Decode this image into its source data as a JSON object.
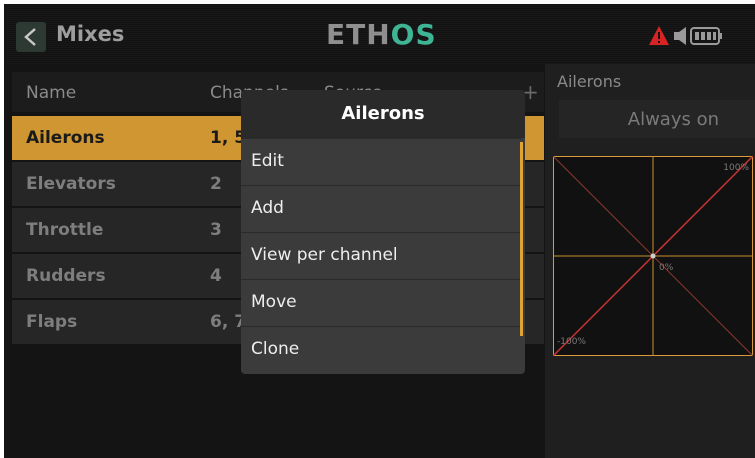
{
  "header": {
    "title": "Mixes",
    "logo_part1": "ETH",
    "logo_part2": "OS",
    "icons": [
      "back-icon",
      "warning-icon",
      "speaker-icon",
      "battery-icon"
    ],
    "accent_color": "#cf9631",
    "logo_accent": "#3fb596",
    "warning_color": "#d92323"
  },
  "list": {
    "columns": [
      "Name",
      "Channels",
      "Source"
    ],
    "add_label": "+",
    "rows": [
      {
        "name": "Ailerons",
        "channels": "1, 5",
        "selected": true
      },
      {
        "name": "Elevators",
        "channels": "2"
      },
      {
        "name": "Throttle",
        "channels": "3"
      },
      {
        "name": "Rudders",
        "channels": "4"
      },
      {
        "name": "Flaps",
        "channels": "6, 7"
      }
    ]
  },
  "right_panel": {
    "title": "Ailerons",
    "value": "Always on",
    "curve": {
      "top_right_label": "100%",
      "center_label": "0%",
      "bottom_left_label": "-100%"
    }
  },
  "popup": {
    "title": "Ailerons",
    "items": [
      "Edit",
      "Add",
      "View per channel",
      "Move",
      "Clone"
    ]
  }
}
